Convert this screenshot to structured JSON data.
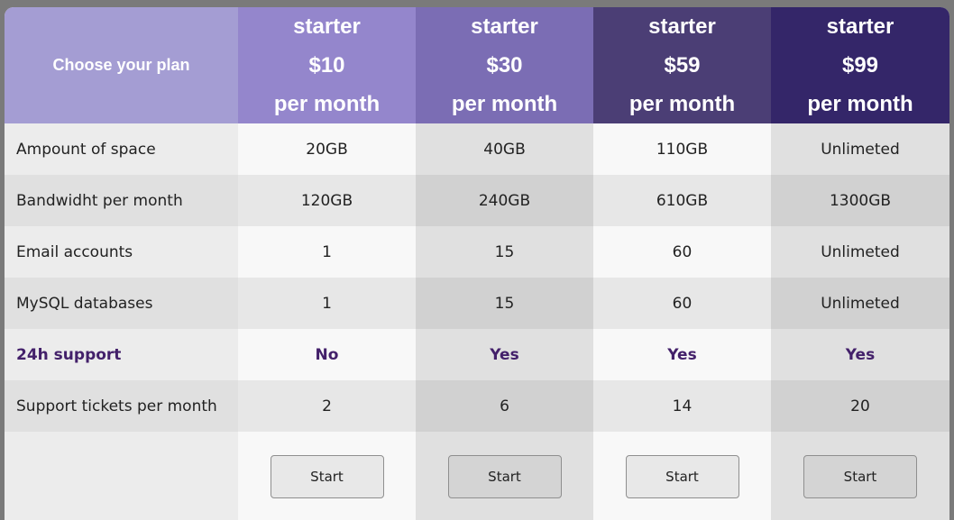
{
  "header": {
    "corner_label": "Choose your plan",
    "plans": [
      {
        "name": "starter",
        "price": "$10",
        "period": "per month"
      },
      {
        "name": "starter",
        "price": "$30",
        "period": "per month"
      },
      {
        "name": "starter",
        "price": "$59",
        "period": "per month"
      },
      {
        "name": "starter",
        "price": "$99",
        "period": "per month"
      }
    ]
  },
  "rows": [
    {
      "label": "Ampount of space",
      "values": [
        "20GB",
        "40GB",
        "110GB",
        "Unlimeted"
      ]
    },
    {
      "label": "Bandwidht per month",
      "values": [
        "120GB",
        "240GB",
        "610GB",
        "1300GB"
      ]
    },
    {
      "label": "Email accounts",
      "values": [
        "1",
        "15",
        "60",
        "Unlimeted"
      ]
    },
    {
      "label": "MySQL databases",
      "values": [
        "1",
        "15",
        "60",
        "Unlimeted"
      ]
    },
    {
      "label": "24h support",
      "values": [
        "No",
        "Yes",
        "Yes",
        "Yes"
      ]
    },
    {
      "label": "Support tickets per month",
      "values": [
        "2",
        "6",
        "14",
        "20"
      ]
    }
  ],
  "buttons": [
    "Start",
    "Start",
    "Start",
    "Start"
  ],
  "colors": {
    "corner": "#a49dd3",
    "plan_headers": [
      "#9486cc",
      "#7b6db4",
      "#4b3e75",
      "#342669"
    ],
    "highlight_text": "#43206a"
  }
}
